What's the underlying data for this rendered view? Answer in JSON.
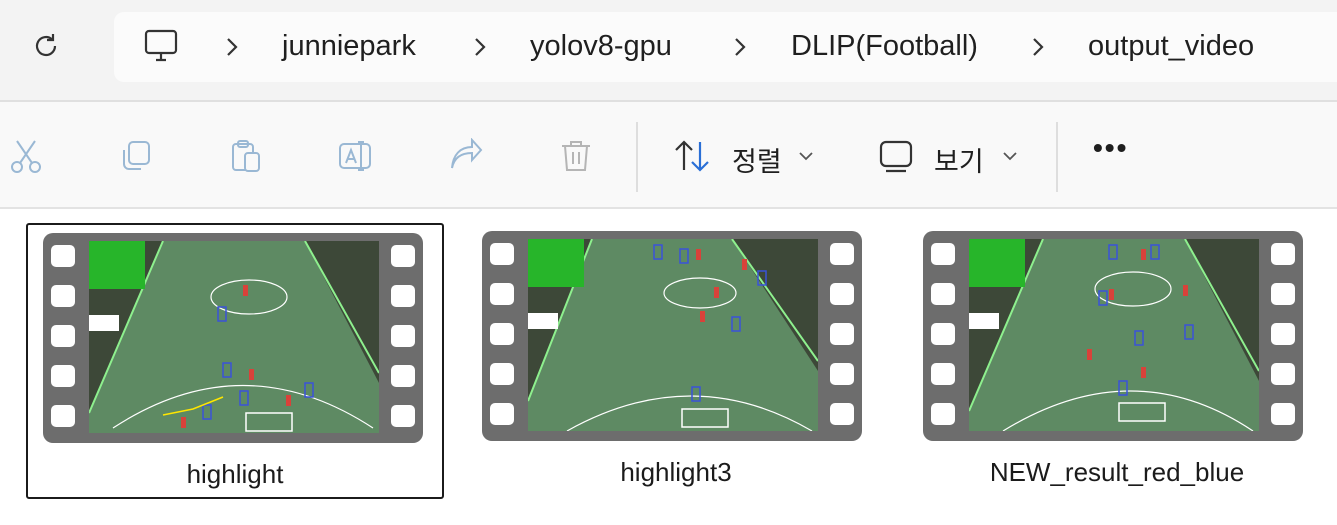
{
  "address_bar": {
    "refresh_icon": "refresh-icon",
    "computer_icon": "computer-icon",
    "breadcrumbs": [
      "junniepark",
      "yolov8-gpu",
      "DLIP(Football)",
      "output_video"
    ]
  },
  "toolbar": {
    "cut_icon": "scissors-icon",
    "copy_icon": "copy-icon",
    "paste_icon": "paste-icon",
    "rename_icon": "rename-icon",
    "share_icon": "share-icon",
    "delete_icon": "trash-icon",
    "sort_label": "정렬",
    "view_label": "보기",
    "more_label": "•••"
  },
  "files": [
    {
      "name": "highlight",
      "selected": true
    },
    {
      "name": "highlight3",
      "selected": false
    },
    {
      "name": "NEW_result_red_blue",
      "selected": false
    }
  ],
  "colors": {
    "pitch": "#5e8a63",
    "film_strip": "#6d6d6d",
    "player_red": "#d9423a",
    "player_blue": "#3a52d9",
    "minimap": "#27b52a"
  }
}
